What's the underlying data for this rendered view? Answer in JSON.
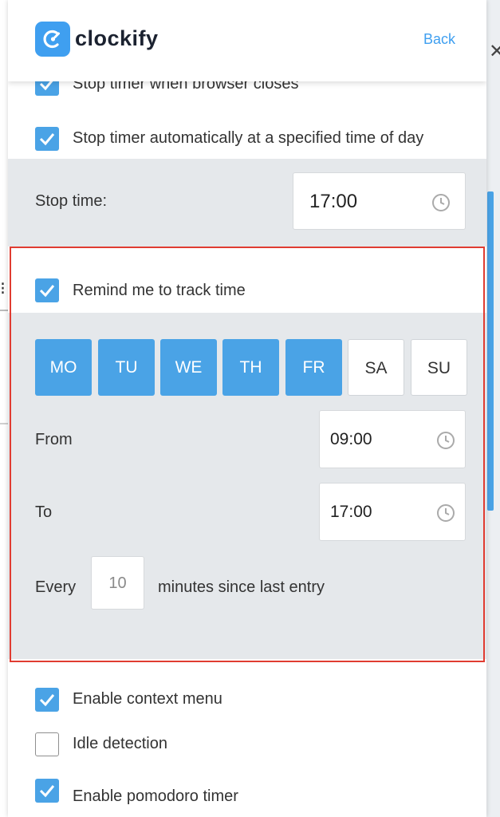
{
  "app": {
    "name": "clockify",
    "back_label": "Back"
  },
  "options": {
    "stop_on_browser_close": {
      "label": "Stop timer when browser closes",
      "checked": true
    },
    "stop_at_time": {
      "label": "Stop timer automatically at a specified time of day",
      "checked": true
    },
    "stop_time": {
      "label": "Stop time:",
      "value": "17:00"
    },
    "remind": {
      "label": "Remind me to track time",
      "checked": true,
      "days": [
        {
          "label": "MO",
          "selected": true
        },
        {
          "label": "TU",
          "selected": true
        },
        {
          "label": "WE",
          "selected": true
        },
        {
          "label": "TH",
          "selected": true
        },
        {
          "label": "FR",
          "selected": true
        },
        {
          "label": "SA",
          "selected": false
        },
        {
          "label": "SU",
          "selected": false
        }
      ],
      "from": {
        "label": "From",
        "value": "09:00"
      },
      "to": {
        "label": "To",
        "value": "17:00"
      },
      "every": {
        "prefix": "Every",
        "value": "10",
        "suffix": "minutes since last entry"
      }
    },
    "context_menu": {
      "label": "Enable context menu",
      "checked": true
    },
    "idle_detection": {
      "label": "Idle detection",
      "checked": false
    },
    "pomodoro": {
      "label": "Enable pomodoro timer",
      "checked": true
    }
  },
  "colors": {
    "accent": "#4aa3e6",
    "brand": "#3f9ff0",
    "highlight_border": "#e03c31",
    "section_gray": "#e5e8eb"
  },
  "icons": [
    "clockify-logo-icon",
    "checkmark-icon",
    "clock-icon"
  ]
}
